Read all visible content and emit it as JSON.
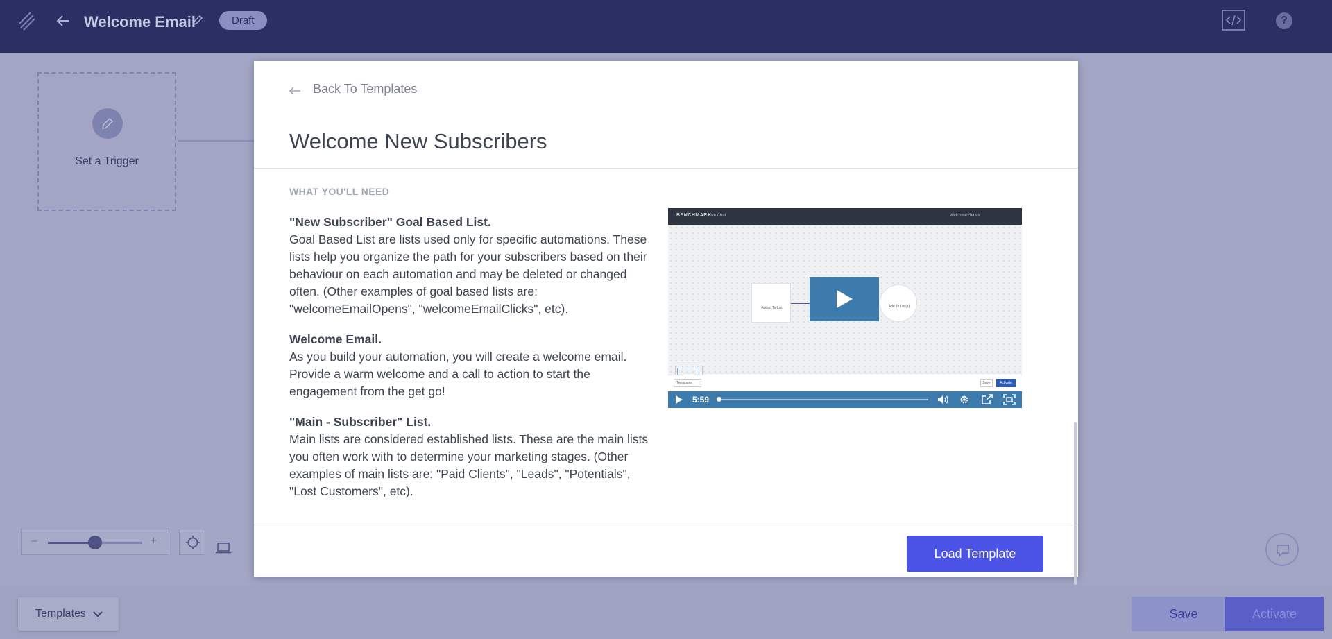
{
  "header": {
    "title": "Welcome Email",
    "status_badge": "Draft",
    "help_label": "?"
  },
  "canvas": {
    "trigger_label": "Set a Trigger",
    "zoom_minus": "–",
    "zoom_plus": "+",
    "zoom_level": 0.5
  },
  "bottom_bar": {
    "templates_label": "Templates",
    "save_label": "Save",
    "activate_label": "Activate"
  },
  "modal": {
    "back_label": "Back To Templates",
    "title": "Welcome New Subscribers",
    "section_heading": "WHAT YOU'LL NEED",
    "blocks": [
      {
        "title": "\"New Subscriber\" Goal Based List.",
        "body": "Goal Based List are lists used only for specific automations. These lists help you organize the path for your subscribers based on their behaviour on each automation and may be deleted or changed often. (Other examples of goal based lists are: \"welcomeEmailOpens\", \"welcomeEmailClicks\", etc)."
      },
      {
        "title": "Welcome Email.",
        "body": "As you build your automation, you will create a welcome email. Provide a warm welcome and a call to action to start the engagement from the get go!"
      },
      {
        "title": "\"Main - Subscriber\" List.",
        "body": "Main lists are considered established lists. These are the main lists you often work with to determine your marketing stages. (Other examples of main lists are: \"Paid Clients\", \"Leads\", \"Potentials\", \"Lost Customers\", etc)."
      }
    ],
    "video": {
      "duration": "5:59",
      "progress": 0.01,
      "thumb_brand": "BENCHMARK",
      "thumb_tab": "Live Chat",
      "thumb_title": "Welcome Series",
      "thumb_node_1": "Added To List",
      "thumb_node_2": "Add To List(s)",
      "thumb_templates": "Templates",
      "thumb_save": "Save",
      "thumb_activate": "Activate"
    },
    "load_button": "Load Template"
  },
  "colors": {
    "topbar": "#2b2f63",
    "primary_button": "#4b52e6",
    "video_accent": "#3e7bad"
  }
}
